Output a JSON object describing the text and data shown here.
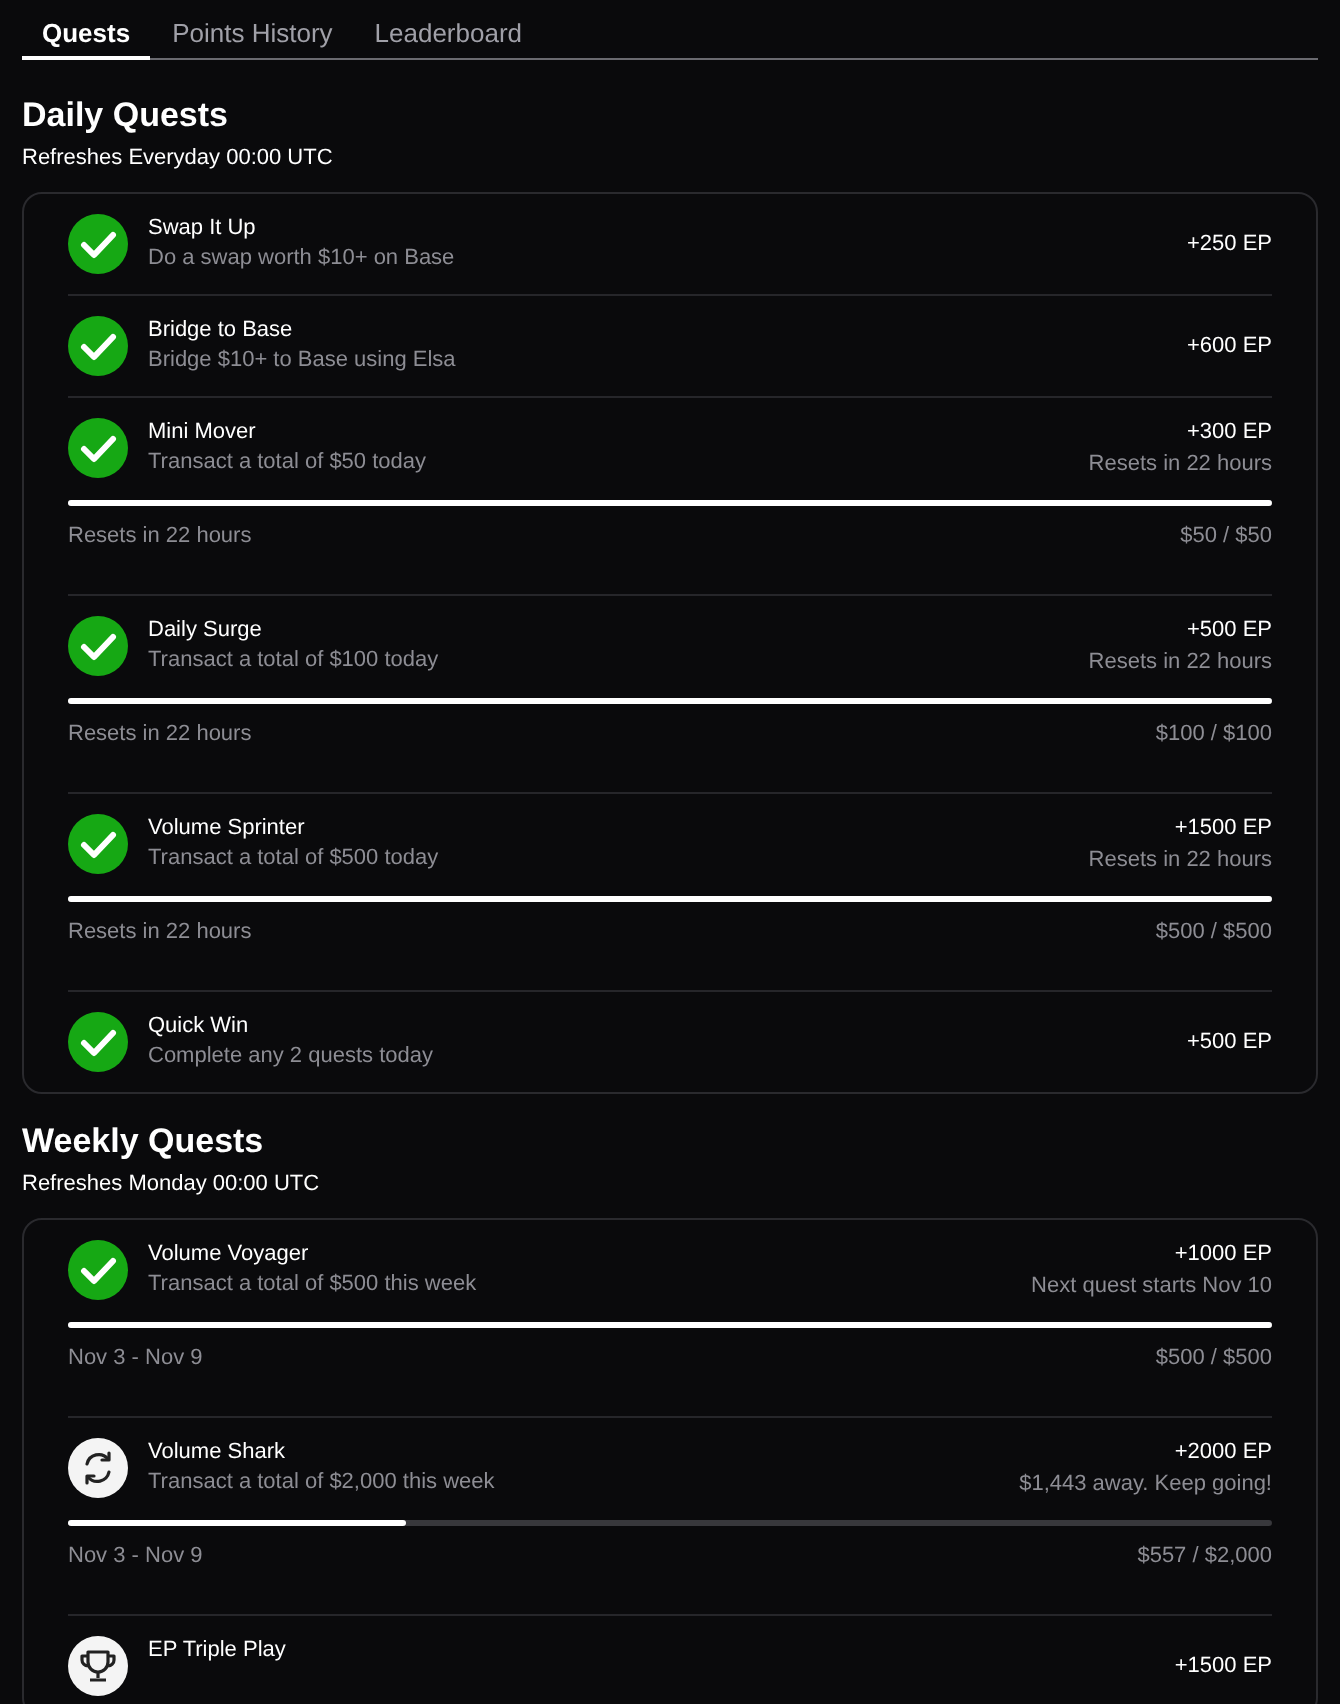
{
  "tabs": [
    {
      "label": "Quests",
      "selected": true
    },
    {
      "label": "Points History",
      "selected": false
    },
    {
      "label": "Leaderboard",
      "selected": false
    }
  ],
  "sections": [
    {
      "title": "Daily Quests",
      "subtitle": "Refreshes Everyday 00:00 UTC",
      "quests": [
        {
          "kind": "simple",
          "completed": true,
          "title": "Swap It Up",
          "description": "Do a swap worth $10+ on Base",
          "reward": "+250 EP"
        },
        {
          "kind": "simple",
          "completed": true,
          "title": "Bridge to Base",
          "description": "Bridge $10+ to Base using Elsa",
          "reward": "+600 EP"
        },
        {
          "kind": "progress",
          "completed": true,
          "title": "Mini Mover",
          "description": "Transact a total of $50 today",
          "reward": "+300 EP",
          "note": "Resets in 22 hours",
          "level": 1,
          "period": "Resets in 22 hours",
          "progress": "$50 / $50"
        },
        {
          "kind": "progress",
          "completed": true,
          "title": "Daily Surge",
          "description": "Transact a total of $100 today",
          "reward": "+500 EP",
          "note": "Resets in 22 hours",
          "level": 1,
          "period": "Resets in 22 hours",
          "progress": "$100 / $100"
        },
        {
          "kind": "progress",
          "completed": true,
          "title": "Volume Sprinter",
          "description": "Transact a total of $500 today",
          "reward": "+1500 EP",
          "note": "Resets in 22 hours",
          "level": 1,
          "period": "Resets in 22 hours",
          "progress": "$500 / $500"
        },
        {
          "kind": "simple",
          "completed": true,
          "title": "Quick Win",
          "description": "Complete any 2 quests today",
          "reward": "+500 EP"
        }
      ]
    },
    {
      "title": "Weekly Quests",
      "subtitle": "Refreshes Monday 00:00 UTC",
      "quests": [
        {
          "kind": "progress",
          "completed": true,
          "title": "Volume Voyager",
          "description": "Transact a total of $500 this week",
          "reward": "+1000 EP",
          "note": "Next quest starts Nov 10",
          "level": 1,
          "period": "Nov 3 - Nov 9",
          "progress": "$500 / $500"
        },
        {
          "kind": "progress",
          "completed": false,
          "title": "Volume Shark",
          "description": "Transact a total of $2,000 this week",
          "reward": "+2000 EP",
          "note": "$1,443 away. Keep going!",
          "level": 0.28,
          "period": "Nov 3 - Nov 9",
          "progress": "$557 / $2,000"
        },
        {
          "kind": "simple",
          "completed": false,
          "title": "EP Triple Play",
          "reward": "+1500 EP"
        }
      ]
    }
  ]
}
